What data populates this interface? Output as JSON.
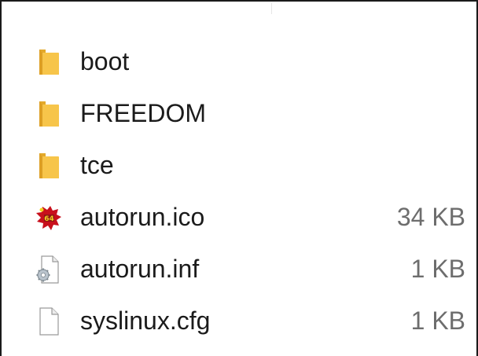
{
  "explorer": {
    "files": [
      {
        "name": "boot",
        "size": "",
        "icon": "folder-icon"
      },
      {
        "name": "FREEDOM",
        "size": "",
        "icon": "folder-icon"
      },
      {
        "name": "tce",
        "size": "",
        "icon": "folder-icon"
      },
      {
        "name": "autorun.ico",
        "size": "34 KB",
        "icon": "c64-logo-icon"
      },
      {
        "name": "autorun.inf",
        "size": "1 KB",
        "icon": "settings-file-icon"
      },
      {
        "name": "syslinux.cfg",
        "size": "1 KB",
        "icon": "blank-file-icon"
      }
    ]
  },
  "colors": {
    "folder": "#f7c54a",
    "folder_dark": "#e3a92b",
    "text": "#1b1b1b",
    "size_text": "#6d6d6d",
    "frame": "#1a1a1a",
    "c64_red": "#c8101c",
    "c64_yellow": "#f0d020"
  }
}
